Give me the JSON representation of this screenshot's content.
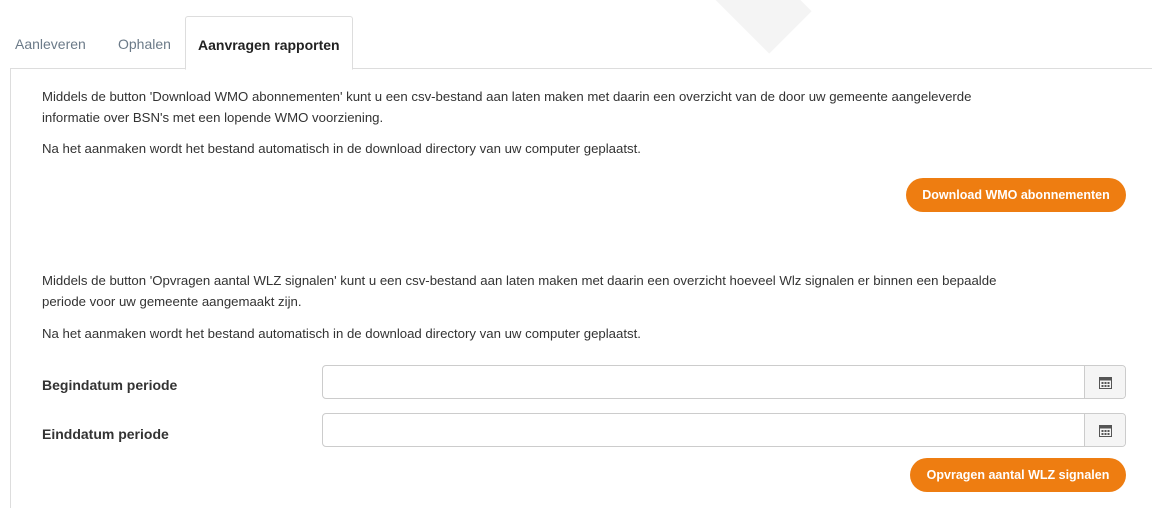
{
  "tabs": [
    {
      "label": "Aanleveren"
    },
    {
      "label": "Ophalen"
    },
    {
      "label": "Aanvragen rapporten"
    }
  ],
  "wmo": {
    "description_line1": "Middels de button 'Download WMO abonnementen' kunt u een csv-bestand aan laten maken met daarin een overzicht van de door uw gemeente aangeleverde",
    "description_line2": "informatie over BSN's met een lopende WMO voorziening.",
    "note": "Na het aanmaken wordt het bestand automatisch in de download directory van uw computer geplaatst.",
    "button_label": "Download WMO abonnementen"
  },
  "wlz": {
    "description_line1": "Middels de button 'Opvragen aantal WLZ signalen' kunt u een csv-bestand aan laten maken met daarin een overzicht hoeveel Wlz signalen er binnen een bepaalde",
    "description_line2": "periode voor uw gemeente aangemaakt zijn.",
    "note": "Na het aanmaken wordt het bestand automatisch in de download directory van uw computer geplaatst.",
    "start_label": "Begindatum periode",
    "start_value": "",
    "end_label": "Einddatum periode",
    "end_value": "",
    "button_label": "Opvragen aantal WLZ signalen"
  },
  "icons": {
    "calendar": "calendar-icon"
  },
  "colors": {
    "accent": "#ee7d11",
    "tab_inactive": "#6b7a88"
  }
}
